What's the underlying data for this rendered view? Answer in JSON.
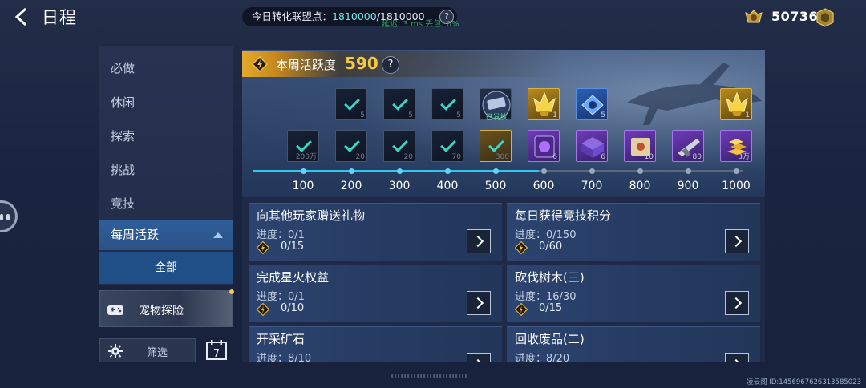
{
  "header": {
    "title": "日程",
    "conversion_label": "今日转化联盟点：",
    "conversion_current": "1810000",
    "conversion_total": "/1810000",
    "conversion_help": "?",
    "net_stats": "延迟: 3 ms  丢包: 0%",
    "currency_value": "50736"
  },
  "sidebar": {
    "items": [
      {
        "label": "必做"
      },
      {
        "label": "休闲"
      },
      {
        "label": "探索"
      },
      {
        "label": "挑战"
      },
      {
        "label": "竞技"
      }
    ],
    "active_label": "每周活跃",
    "sub_active_label": "全部",
    "pet_label": "宠物探险",
    "filter_label": "筛选",
    "calendar_day": "7"
  },
  "activity": {
    "label": "本周活跃度",
    "value": "590",
    "help": "?",
    "progress_value": 590,
    "progress_max": 1000,
    "top_rewards": [
      {
        "kind": "done",
        "qty": "5"
      },
      {
        "kind": "done",
        "qty": "5"
      },
      {
        "kind": "done",
        "qty": "5"
      },
      {
        "kind": "issued",
        "qty": "",
        "tag": "已发放"
      },
      {
        "kind": "gold-crystal",
        "qty": "1"
      },
      {
        "kind": "blue-gem",
        "qty": "5"
      },
      {
        "kind": "empty",
        "qty": ""
      },
      {
        "kind": "empty",
        "qty": ""
      },
      {
        "kind": "gold-crystal",
        "qty": "1"
      }
    ],
    "bottom_rewards": [
      {
        "kind": "done",
        "qty": "200万"
      },
      {
        "kind": "done",
        "qty": "20"
      },
      {
        "kind": "done",
        "qty": "20"
      },
      {
        "kind": "done",
        "qty": "70"
      },
      {
        "kind": "done-gold",
        "qty": "300"
      },
      {
        "kind": "purple-orb",
        "qty": "6"
      },
      {
        "kind": "purple-box",
        "qty": "6"
      },
      {
        "kind": "purple-map",
        "qty": "10"
      },
      {
        "kind": "purple-gun",
        "qty": "80"
      },
      {
        "kind": "gold-bars",
        "qty": "3万"
      }
    ],
    "ticks": [
      "100",
      "200",
      "300",
      "400",
      "500",
      "600",
      "700",
      "800",
      "900",
      "1000"
    ]
  },
  "tasks": [
    {
      "title": "向其他玩家赠送礼物",
      "progress": "进度：0/1",
      "reward": "0/15"
    },
    {
      "title": "每日获得竞技积分",
      "progress": "进度：0/150",
      "reward": "0/60"
    },
    {
      "title": "完成星火权益",
      "progress": "进度：0/1",
      "reward": "0/10"
    },
    {
      "title": "砍伐树木(三)",
      "progress": "进度：16/30",
      "reward": "0/15"
    },
    {
      "title": "开采矿石",
      "progress": "进度：8/10",
      "reward": ""
    },
    {
      "title": "回收废品(二)",
      "progress": "进度：8/20",
      "reward": ""
    }
  ],
  "footer": {
    "id_text": "凌云阁  ID:1456967626313585023"
  },
  "colors": {
    "accent_gold": "#f5c842",
    "progress_cyan": "#30c6f0",
    "sidebar_active": "#2f5f9a"
  }
}
